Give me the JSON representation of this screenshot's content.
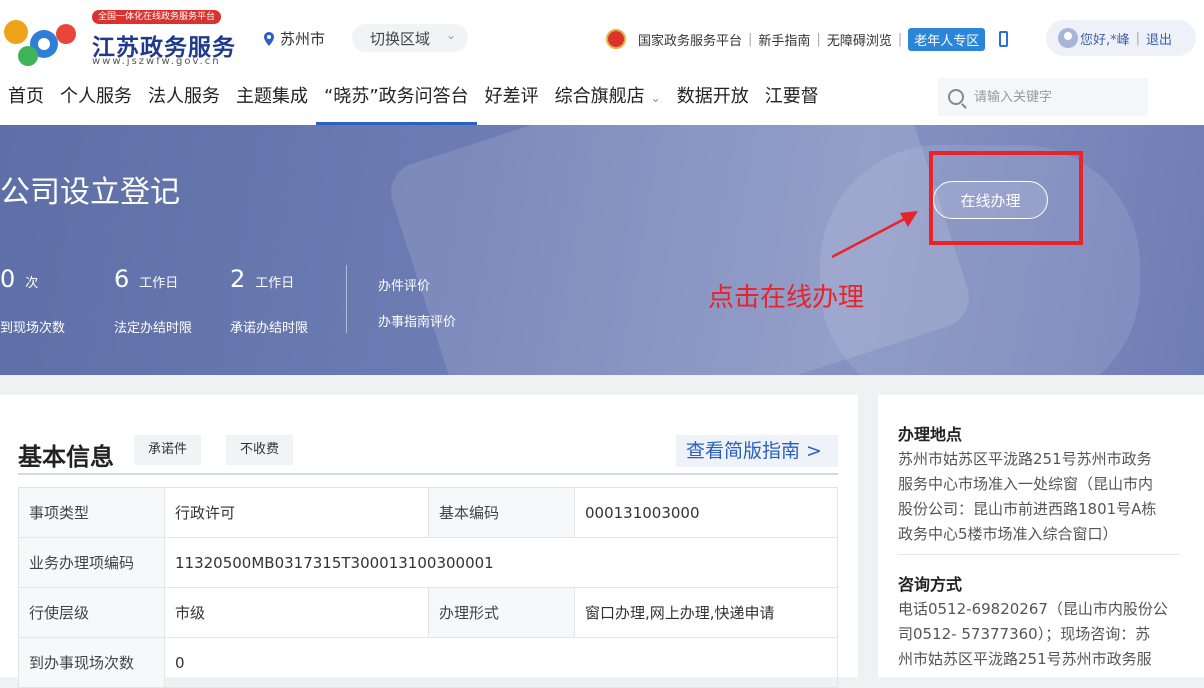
{
  "logo": {
    "badge": "全国一体化在线政务服务平台",
    "title": "江苏政务服务",
    "url": "www.jszwfw.gov.cn"
  },
  "location": {
    "city": "苏州市",
    "switch_label": "切换区域"
  },
  "top_links": {
    "national": "国家政务服务平台",
    "guide": "新手指南",
    "accessible": "无障碍浏览",
    "elder": "老年人专区"
  },
  "user": {
    "greeting": "您好,*峰",
    "logout": "退出"
  },
  "nav": [
    "首页",
    "个人服务",
    "法人服务",
    "主题集成",
    "“晓苏”政务问答台",
    "好差评",
    "综合旗舰店",
    "数据开放",
    "江要督"
  ],
  "search": {
    "placeholder": "请输入关键字"
  },
  "banner": {
    "title": "公司设立登记",
    "stats": [
      {
        "num": "0",
        "unit": "次",
        "label": "到现场次数"
      },
      {
        "num": "6",
        "unit": "工作日",
        "label": "法定办结时限"
      },
      {
        "num": "2",
        "unit": "工作日",
        "label": "承诺办结时限"
      }
    ],
    "eval_links": [
      "办件评价",
      "办事指南评价"
    ],
    "online_button": "在线办理",
    "annotation": "点击在线办理"
  },
  "basic_info": {
    "title": "基本信息",
    "tags": [
      "承诺件",
      "不收费"
    ],
    "guide_link": "查看简版指南 >",
    "rows": [
      {
        "k1": "事项类型",
        "v1": "行政许可",
        "k2": "基本编码",
        "v2": "000131003000"
      },
      {
        "k1": "业务办理项编码",
        "v1": "11320500MB0317315T300013100300001"
      },
      {
        "k1": "行使层级",
        "v1": "市级",
        "k2": "办理形式",
        "v2": "窗口办理,网上办理,快递申请"
      },
      {
        "k1": "到办事现场次数",
        "v1": "0"
      }
    ]
  },
  "side": {
    "address_title": "办理地点",
    "address_lines": [
      "苏州市姑苏区平泷路251号苏州市政务",
      "服务中心市场准入一处综窗（昆山市内",
      "股份公司：昆山市前进西路1801号A栋",
      "政务中心5楼市场准入综合窗口）"
    ],
    "contact_title": "咨询方式",
    "contact_lines": [
      "电话0512-69820267（昆山市内股份公",
      "司0512- 57377360）；现场咨询：苏",
      "州市姑苏区平泷路251号苏州市政务服"
    ]
  },
  "colors": {
    "nav_active": "#2d5fc4",
    "annotation_red": "#e8232a",
    "banner": "#6d7db4"
  }
}
